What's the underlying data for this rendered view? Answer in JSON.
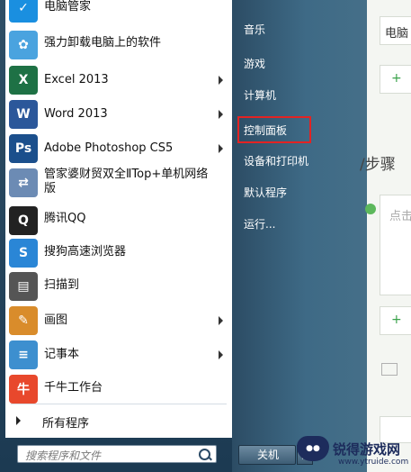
{
  "programs": [
    {
      "label": "电脑管家",
      "icon": "tencent-pc-manager-icon",
      "color": "#1a8fe0",
      "glyph": "✓",
      "arrow": false
    },
    {
      "label": "强力卸载电脑上的软件",
      "icon": "uninstall-software-icon",
      "color": "#4aa3df",
      "glyph": "✿",
      "arrow": false
    },
    {
      "label": "Excel 2013",
      "icon": "excel-icon",
      "color": "#1e7145",
      "glyph": "X",
      "arrow": true
    },
    {
      "label": "Word 2013",
      "icon": "word-icon",
      "color": "#2b579a",
      "glyph": "W",
      "arrow": true
    },
    {
      "label": "Adobe Photoshop CS5",
      "icon": "photoshop-icon",
      "color": "#1b4f8c",
      "glyph": "Ps",
      "arrow": true
    },
    {
      "label": "管家婆财贸双全ⅡTop+单机网络版",
      "icon": "network-icon",
      "color": "#6c8bb4",
      "glyph": "⇄",
      "arrow": false
    },
    {
      "label": "腾讯QQ",
      "icon": "qq-penguin-icon",
      "color": "#222222",
      "glyph": "Q",
      "arrow": false
    },
    {
      "label": "搜狗高速浏览器",
      "icon": "sogou-browser-icon",
      "color": "#2a86d6",
      "glyph": "S",
      "arrow": false
    },
    {
      "label": "扫描到",
      "icon": "scanner-icon",
      "color": "#555555",
      "glyph": "▤",
      "arrow": false
    },
    {
      "label": "画图",
      "icon": "paint-icon",
      "color": "#d98c2b",
      "glyph": "✎",
      "arrow": true
    },
    {
      "label": "记事本",
      "icon": "notepad-icon",
      "color": "#3d8fcf",
      "glyph": "≡",
      "arrow": true
    },
    {
      "label": "千牛工作台",
      "icon": "qianniu-icon",
      "color": "#e8482c",
      "glyph": "牛",
      "arrow": false
    }
  ],
  "all_programs": "所有程序",
  "search_placeholder": "搜索程序和文件",
  "right_links": [
    "音乐",
    "游戏",
    "计算机",
    "控制面板",
    "设备和打印机",
    "默认程序",
    "运行..."
  ],
  "highlighted_link": "控制面板",
  "shutdown": "关机",
  "background": {
    "top_field": "电脑",
    "step_heading": "/步骤",
    "click_hint": "点击",
    "plus": "+"
  },
  "watermark": {
    "title": "锐得游戏网",
    "url": "www.ytruide.com"
  },
  "colors": {
    "highlight": "#e32323",
    "right_pane": "#3e6a86"
  }
}
